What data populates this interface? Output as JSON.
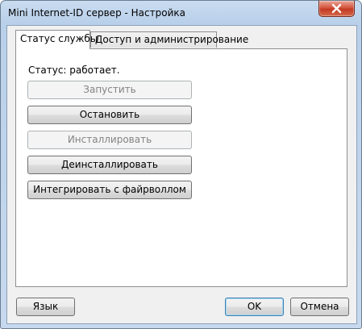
{
  "window": {
    "title": "Mini Internet-ID сервер - Настройка"
  },
  "tabs": [
    {
      "label": "Статус службы",
      "active": true
    },
    {
      "label": "Доступ и администрирование",
      "active": false
    }
  ],
  "service": {
    "status_text": "Статус: работает.",
    "buttons": [
      {
        "label": "Запустить",
        "enabled": false
      },
      {
        "label": "Остановить",
        "enabled": true
      },
      {
        "label": "Инсталлировать",
        "enabled": false
      },
      {
        "label": "Деинсталлировать",
        "enabled": true
      },
      {
        "label": "Интегрировать с файрволлом",
        "enabled": true
      }
    ]
  },
  "footer": {
    "language_label": "Язык",
    "ok_label": "OK",
    "cancel_label": "Отмена"
  },
  "icons": {
    "close": "close-icon"
  }
}
